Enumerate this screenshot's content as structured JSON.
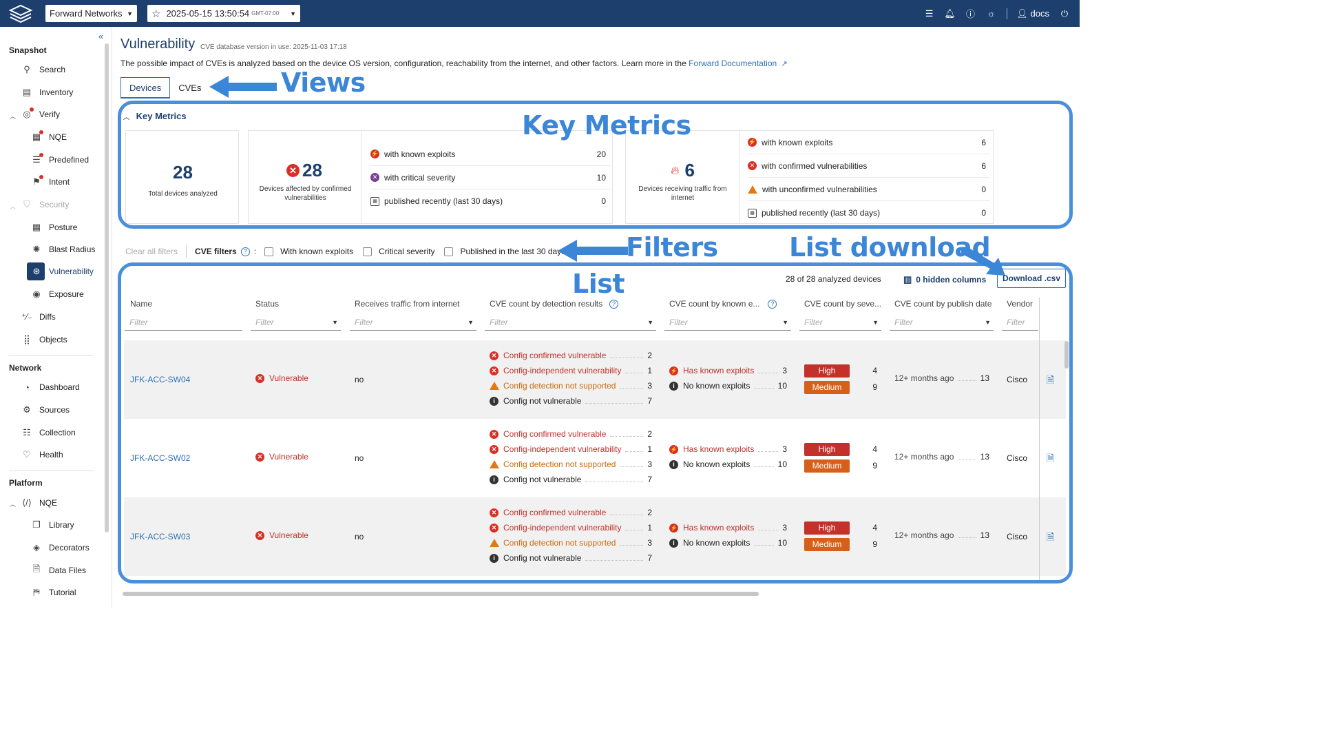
{
  "topbar": {
    "network": "Forward Networks",
    "snapshot_date": "2025-05-15  13:50:54",
    "snapshot_tz": "GMT-07:00",
    "user": "docs"
  },
  "sidebar": {
    "snapshot_section": "Snapshot",
    "snapshot_items": [
      "Search",
      "Inventory",
      "Verify",
      "NQE",
      "Predefined",
      "Intent",
      "Security",
      "Posture",
      "Blast Radius",
      "Vulnerability",
      "Exposure",
      "Diffs",
      "Objects"
    ],
    "network_section": "Network",
    "network_items": [
      "Dashboard",
      "Sources",
      "Collection",
      "Health"
    ],
    "platform_section": "Platform",
    "platform_items": [
      "NQE",
      "Library",
      "Decorators",
      "Data Files",
      "Tutorial"
    ]
  },
  "page": {
    "title": "Vulnerability",
    "cve_db": "CVE database version in use: 2025-11-03 17:18",
    "description": "The possible impact of CVEs is analyzed based on the device OS version, configuration, reachability from the internet, and other factors. Learn more in the",
    "doc_link": "Forward Documentation",
    "tabs": [
      "Devices",
      "CVEs"
    ]
  },
  "annotations": {
    "views": "Views",
    "key_metrics": "Key Metrics",
    "filters": "Filters",
    "list_download": "List download",
    "list": "List"
  },
  "key_metrics": {
    "title": "Key Metrics",
    "total": "28",
    "total_label": "Total devices analyzed",
    "affected": "28",
    "affected_label": "Devices affected by confirmed vulnerabilities",
    "affected_rows": [
      {
        "label": "with known exploits",
        "value": "20"
      },
      {
        "label": "with critical severity",
        "value": "10"
      },
      {
        "label": "published recently (last 30 days)",
        "value": "0"
      }
    ],
    "internet": "6",
    "internet_label": "Devices receiving traffic from internet",
    "internet_rows": [
      {
        "label": "with known exploits",
        "value": "6"
      },
      {
        "label": "with confirmed vulnerabilities",
        "value": "6"
      },
      {
        "label": "with unconfirmed vulnerabilities",
        "value": "0"
      },
      {
        "label": "published recently (last 30 days)",
        "value": "0"
      }
    ]
  },
  "filters": {
    "clear": "Clear all filters",
    "cve_filters": "CVE filters",
    "options": [
      "With known exploits",
      "Critical severity",
      "Published in the last 30 days"
    ]
  },
  "list": {
    "count": "28 of 28 analyzed devices",
    "hidden_columns": "0 hidden columns",
    "download": "Download .csv",
    "columns": [
      "Name",
      "Status",
      "Receives traffic from internet",
      "CVE count by detection results",
      "CVE count by known e...",
      "CVE count by seve...",
      "CVE count by publish date",
      "Vendor"
    ],
    "filter_placeholder": "Filter",
    "detection_labels": [
      "Config confirmed vulnerable",
      "Config-independent vulnerability",
      "Config detection not supported",
      "Config not vulnerable"
    ],
    "exploit_labels": [
      "Has known exploits",
      "No known exploits"
    ],
    "severity_labels": [
      "High",
      "Medium"
    ],
    "rows": [
      {
        "name": "JFK-ACC-SW04",
        "status": "Vulnerable",
        "internet": "no",
        "det": [
          "2",
          "1",
          "3",
          "7"
        ],
        "exp": [
          "3",
          "10"
        ],
        "sev": [
          "4",
          "9"
        ],
        "pub_label": "12+ months ago",
        "pub": "13",
        "vendor": "Cisco"
      },
      {
        "name": "JFK-ACC-SW02",
        "status": "Vulnerable",
        "internet": "no",
        "det": [
          "2",
          "1",
          "3",
          "7"
        ],
        "exp": [
          "3",
          "10"
        ],
        "sev": [
          "4",
          "9"
        ],
        "pub_label": "12+ months ago",
        "pub": "13",
        "vendor": "Cisco"
      },
      {
        "name": "JFK-ACC-SW03",
        "status": "Vulnerable",
        "internet": "no",
        "det": [
          "2",
          "1",
          "3",
          "7"
        ],
        "exp": [
          "3",
          "10"
        ],
        "sev": [
          "4",
          "9"
        ],
        "pub_label": "12+ months ago",
        "pub": "13",
        "vendor": "Cisco"
      }
    ]
  }
}
